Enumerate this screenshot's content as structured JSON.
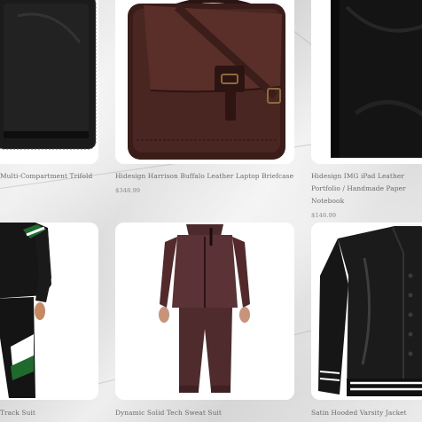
{
  "products": [
    {
      "name": "Multi-Compartment Trifold",
      "price": "",
      "image_icon": "black-trifold-wallet-icon"
    },
    {
      "name": "Hidesign Harrison Buffalo Leather Laptop Briefcase",
      "price": "$348.99",
      "image_icon": "brown-leather-briefcase-icon"
    },
    {
      "name": "Hidesign IMG iPad Leather Portfolio / Handmade Paper Notebook",
      "price": "$146.99",
      "image_icon": "black-leather-portfolio-icon"
    },
    {
      "name": "Track Suit",
      "price": "",
      "image_icon": "black-green-tracksuit-icon"
    },
    {
      "name": "Dynamic Solid Tech Sweat Suit",
      "price": "",
      "image_icon": "maroon-sweat-suit-icon"
    },
    {
      "name": "Satin Hooded Varsity Jacket",
      "price": "",
      "image_icon": "black-satin-varsity-jacket-icon"
    }
  ]
}
